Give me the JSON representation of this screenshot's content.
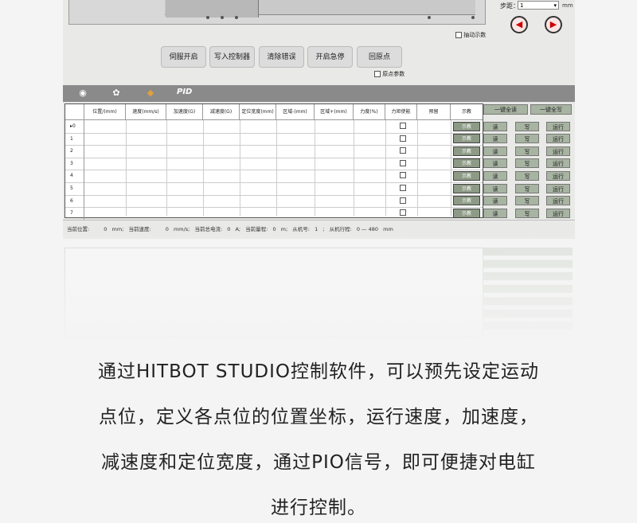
{
  "controls": {
    "step_label": "步距：",
    "step_value": "1",
    "step_unit": "mm",
    "prev_icon": "left-arrow-icon",
    "next_icon": "right-arrow-icon",
    "auto_teach_label": "抽动示数",
    "origin_param_label": "原点参数"
  },
  "buttons": [
    "伺服开启",
    "写入控制器",
    "清除错误",
    "开启急停",
    "回原点"
  ],
  "toolbar": {
    "icons": [
      "record-icon",
      "gears-icon",
      "python-icon"
    ],
    "pid_label": "PID"
  },
  "table": {
    "headers": [
      "位置/(mm)",
      "速度(mm/s)",
      "加速度(G)",
      "减速度(G)",
      "定位宽度(mm)",
      "区域-(mm)",
      "区域+(mm)",
      "力度(%)",
      "力矩使能",
      "预留",
      "示教"
    ],
    "rows": [
      "▸0",
      "1",
      "2",
      "3",
      "4",
      "5",
      "6",
      "7"
    ],
    "teach_label": "示教",
    "read_all": "一键全读",
    "write_all": "一键全写",
    "read_label": "读",
    "write_label": "写",
    "run_label": "运行"
  },
  "status": {
    "pos_label": "当前位置:",
    "pos_value": "0",
    "pos_unit": "mm;",
    "speed_label": "当前速度:",
    "speed_value": "0",
    "speed_unit": "mm/s;",
    "current_label": "当前总电流:",
    "current_value": "0",
    "current_unit": "A;",
    "range_label": "当前量程:",
    "range_value": "0",
    "range_unit": "m;",
    "slave_label": "从机号:",
    "slave_value": "1",
    "slave_unit": ";",
    "stroke_label": "从机行程:",
    "stroke_value": "0 — 480",
    "stroke_unit": "mm"
  },
  "caption": {
    "line1": "通过HITBOT STUDIO控制软件，可以预先设定运动",
    "line2": "点位，定义各点位的位置坐标，运行速度，加速度，",
    "line3": "减速度和定位宽度，通过PIO信号，即可便捷对电缸",
    "line4": "进行控制。"
  }
}
